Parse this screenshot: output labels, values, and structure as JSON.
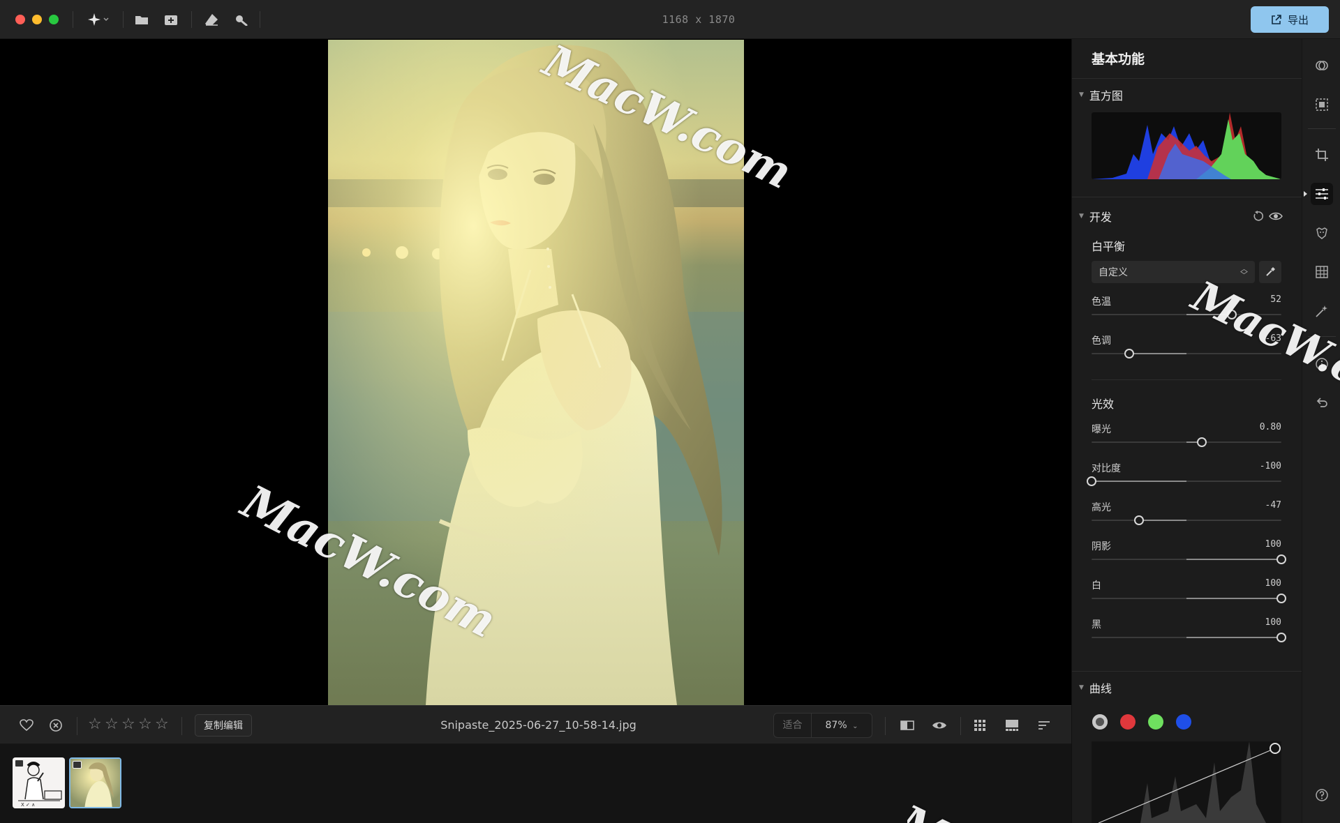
{
  "window": {
    "image_dimensions": "1168 x 1870",
    "export_label": "导出"
  },
  "toolbar": {
    "icons": [
      "magic-icon",
      "folder-icon",
      "import-icon",
      "eraser-icon",
      "magnify-icon"
    ]
  },
  "bottom_bar": {
    "copy_edit_label": "复制编辑",
    "filename": "Snipaste_2025-06-27_10-58-14.jpg",
    "zoom_fit_label": "适合",
    "zoom_level": "87%",
    "rating_stars": 5,
    "rating_value": 0
  },
  "panel": {
    "title": "基本功能",
    "histogram_label": "直方图",
    "develop_label": "开发",
    "white_balance": {
      "label": "白平衡",
      "preset": "自定义",
      "sliders": [
        {
          "label": "色温",
          "value": "52",
          "pos": 0.74
        },
        {
          "label": "色调",
          "value": "-63",
          "pos": 0.2
        }
      ]
    },
    "light": {
      "label": "光效",
      "sliders": [
        {
          "label": "曝光",
          "value": "0.80",
          "pos": 0.58
        },
        {
          "label": "对比度",
          "value": "-100",
          "pos": 0.0
        },
        {
          "label": "高光",
          "value": "-47",
          "pos": 0.25
        },
        {
          "label": "阴影",
          "value": "100",
          "pos": 1.0
        },
        {
          "label": "白",
          "value": "100",
          "pos": 1.0
        },
        {
          "label": "黑",
          "value": "100",
          "pos": 1.0
        }
      ]
    },
    "curves_label": "曲线",
    "curve_channels": [
      "#c8c8c8",
      "#e0383c",
      "#6fe05f",
      "#1f4fe8"
    ]
  },
  "watermark": "MacW.com",
  "colors": {
    "accent": "#8fc6ee",
    "close": "#ff5f57",
    "minimize": "#febc2e",
    "zoom": "#28c840"
  }
}
